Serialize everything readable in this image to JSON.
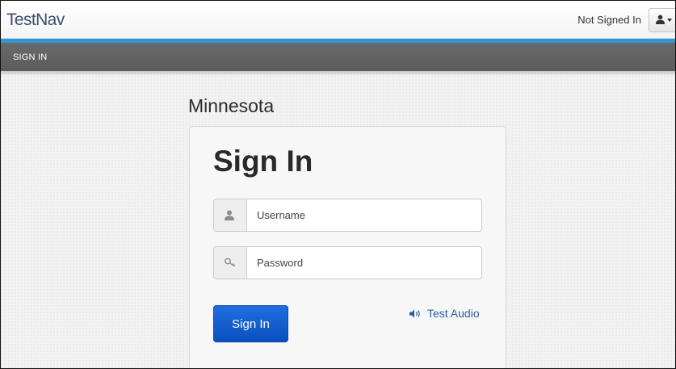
{
  "header": {
    "logo": "TestNav",
    "status": "Not Signed In",
    "user_menu_icon": "user-icon",
    "caret_icon": "caret-down-icon"
  },
  "nav": {
    "items": [
      {
        "label": "SIGN IN"
      }
    ]
  },
  "main": {
    "state_title": "Minnesota",
    "card": {
      "title": "Sign In",
      "username": {
        "placeholder": "Username",
        "value": "",
        "icon": "user-icon"
      },
      "password": {
        "placeholder": "Password",
        "value": "",
        "icon": "key-icon"
      },
      "signin_label": "Sign In",
      "audio_label": "Test Audio",
      "audio_icon": "speaker-icon"
    }
  },
  "colors": {
    "accent_bar": "#2e98d9",
    "nav_bar": "#5f5f5f",
    "primary_button": "#0f5ad0",
    "link": "#2b5f9e"
  }
}
